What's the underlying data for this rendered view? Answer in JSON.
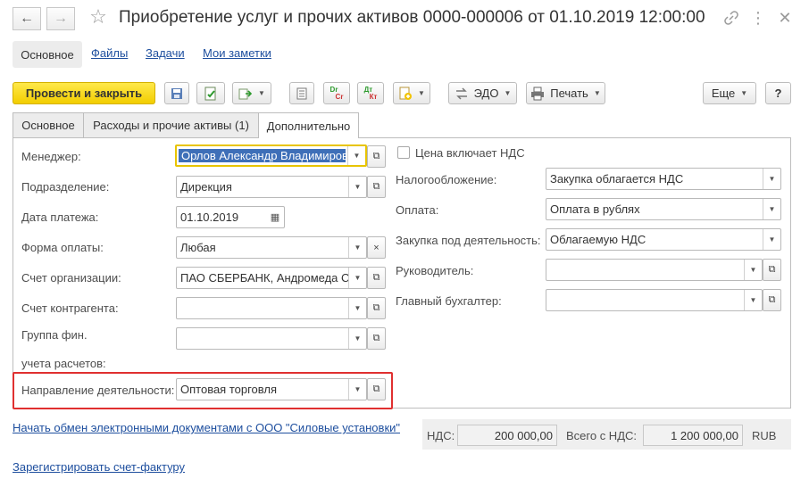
{
  "window": {
    "title": "Приобретение услуг и прочих активов 0000-000006 от 01.10.2019 12:00:00"
  },
  "section_nav": {
    "items": [
      "Основное",
      "Файлы",
      "Задачи",
      "Мои заметки"
    ]
  },
  "toolbar": {
    "post_close_label": "Провести и закрыть",
    "edo_label": "ЭДО",
    "print_label": "Печать",
    "more_label": "Еще",
    "help_label": "?",
    "dt_label": "Dr",
    "dt_label2": "Cr",
    "dtkt_label": "Дт",
    "dtkt_label2": "Кт"
  },
  "tabs": [
    "Основное",
    "Расходы и прочие активы (1)",
    "Дополнительно"
  ],
  "form_left": {
    "manager": {
      "label": "Менеджер:",
      "value": "Орлов Александр Владимиров"
    },
    "department": {
      "label": "Подразделение:",
      "value": "Дирекция"
    },
    "pay_date": {
      "label": "Дата платежа:",
      "value": "01.10.2019"
    },
    "pay_form": {
      "label": "Форма оплаты:",
      "value": "Любая"
    },
    "org_account": {
      "label": "Счет организации:",
      "value": "ПАО СБЕРБАНК, Андромеда С"
    },
    "contractor_account": {
      "label": "Счет контрагента:",
      "value": ""
    },
    "fin_group": {
      "label_line1": "Группа фин.",
      "label_line2": "учета расчетов:",
      "value": ""
    },
    "activity": {
      "label": "Направление деятельности:",
      "value": "Оптовая торговля"
    }
  },
  "form_right": {
    "vat_included_label": "Цена включает НДС",
    "vat_included_checked": false,
    "taxation": {
      "label": "Налогообложение:",
      "value": "Закупка облагается НДС"
    },
    "payment": {
      "label": "Оплата:",
      "value": "Оплата в рублях"
    },
    "purchase_activity": {
      "label": "Закупка под деятельность:",
      "value": "Облагаемую НДС"
    },
    "head": {
      "label": "Руководитель:",
      "value": ""
    },
    "chief_accountant": {
      "label": "Главный бухгалтер:",
      "value": ""
    }
  },
  "footer": {
    "edo_link": "Начать обмен электронными документами с ООО \"Силовые установки\"",
    "invoice_link": "Зарегистрировать счет-фактуру",
    "vat_label": "НДС:",
    "vat_value": "200 000,00",
    "total_label": "Всего с НДС:",
    "total_value": "1 200 000,00",
    "currency": "RUB"
  },
  "colors": {
    "primary_button": "#f2cd00",
    "link": "#1d4e9e",
    "highlight_border": "#e03030",
    "focus_border": "#e8c400"
  }
}
